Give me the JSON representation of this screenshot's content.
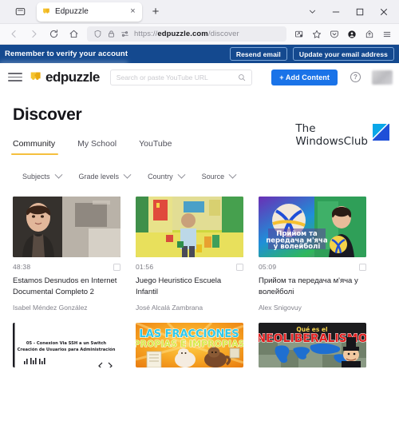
{
  "browser": {
    "tab": {
      "title": "Edpuzzle",
      "favicon": "edpuzzle-puzzle-icon",
      "close": "×"
    },
    "new_tab": "+",
    "tab_list_chevron": "⌄",
    "window_controls": {
      "minimize": "–",
      "maximize": "□",
      "close": "✕"
    },
    "url": {
      "scheme": "https://",
      "host": "edpuzzle.com",
      "path": "/discover"
    },
    "nav": {
      "back": "←",
      "forward": "→",
      "reload": "↻",
      "home": "⌂"
    },
    "url_icons": [
      "shield-icon",
      "lock-icon",
      "tracking-protection-icon"
    ],
    "toolbar_icons": [
      "save-to-device-icon",
      "bookmark-star-icon",
      "pocket-icon",
      "account-circle-icon",
      "share-icon",
      "app-menu-icon"
    ]
  },
  "banner": {
    "message": "Remember to verify your account",
    "resend_label": "Resend email",
    "update_label": "Update your email address",
    "background": "#14498f"
  },
  "appbar": {
    "menu": "hamburger-menu-icon",
    "brand": "edpuzzle",
    "search_placeholder": "Search or paste YouTube URL",
    "search_value": "",
    "add_content_label": "+ Add Content",
    "add_content_color": "#1a73e8",
    "help": "?",
    "avatar": "user-avatar-blurred"
  },
  "page": {
    "title": "Discover",
    "tabs": [
      {
        "label": "Community",
        "active": true
      },
      {
        "label": "My School",
        "active": false
      },
      {
        "label": "YouTube",
        "active": false
      }
    ],
    "active_tab_underline_color": "#f5c03e",
    "filters": [
      {
        "label": "Subjects"
      },
      {
        "label": "Grade levels"
      },
      {
        "label": "Country"
      },
      {
        "label": "Source"
      }
    ],
    "cards": [
      {
        "duration": "48:38",
        "title": "Estamos Desnudos en Internet Documental Completo 2",
        "author": "Isabel Méndez González",
        "thumb": "woman-interview-dark"
      },
      {
        "duration": "01:56",
        "title": "Juego Heuristico Escuela Infantil",
        "author": "José Alcalá Zambrana",
        "thumb": "child-playroom-yellow"
      },
      {
        "duration": "05:09",
        "title": "Прийом та передача м'яча у волейболі",
        "author": "Alex Snigovuy",
        "thumb": "volleyball-teacher",
        "overlay_text": "Прийом та передача м'яча у волейболі"
      }
    ],
    "cards_row2": [
      {
        "thumb": "ssh-switch-slide",
        "line1": "05 - Conexion Via SSH a un Switch",
        "line2": "Creación de Usuarios para Administración"
      },
      {
        "thumb": "fracciones-cartoon",
        "line1": "LAS FRACCIONES",
        "line2": "PROPIAS E IMPROPIAS"
      },
      {
        "thumb": "neoliberalismo-map",
        "line1": "Qué es el",
        "line2": "NEOLIBERALISMO"
      }
    ]
  },
  "watermark": {
    "line1": "The",
    "line2": "WindowsClub"
  }
}
